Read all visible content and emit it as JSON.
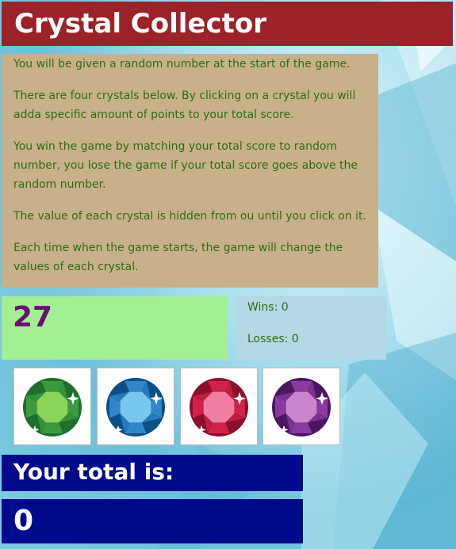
{
  "title": "Crystal Collector",
  "instructions": [
    "You will be given a random number at the start of the game.",
    "There are four crystals below. By clicking on a crystal you will adda specific amount of points to your total score.",
    "You win the game by matching your total score to random number, you lose the game if your total score goes above the random number.",
    "The value of each crystal is hidden from ou until you click on it.",
    "Each time when the game starts, the game will change the values of each crystal."
  ],
  "random_number": "27",
  "wins_text": "Wins: 0",
  "losses_text": "Losses: 0",
  "crystals": [
    {
      "icon": "green-crystal-icon",
      "color_dark": "#1f6e2c",
      "color_mid": "#3c9a3e",
      "color_light": "#8cd35a"
    },
    {
      "icon": "blue-crystal-icon",
      "color_dark": "#0e4f86",
      "color_mid": "#2f86c8",
      "color_light": "#79c7ee"
    },
    {
      "icon": "red-crystal-icon",
      "color_dark": "#8c0f2e",
      "color_mid": "#d0224a",
      "color_light": "#ef7fa3"
    },
    {
      "icon": "purple-crystal-icon",
      "color_dark": "#4a1660",
      "color_mid": "#8a3aa0",
      "color_light": "#cc86cf"
    }
  ],
  "total_label": "Your total is:",
  "total_value": "0",
  "colors": {
    "title_bg": "#9b2229",
    "instructions_bg": "#c8b08a",
    "instructions_text": "#2e6e12",
    "target_bg": "#a3ef94",
    "target_text": "#6a0f74",
    "score_bg": "#b4d8e6",
    "total_bg": "#020a8c"
  }
}
